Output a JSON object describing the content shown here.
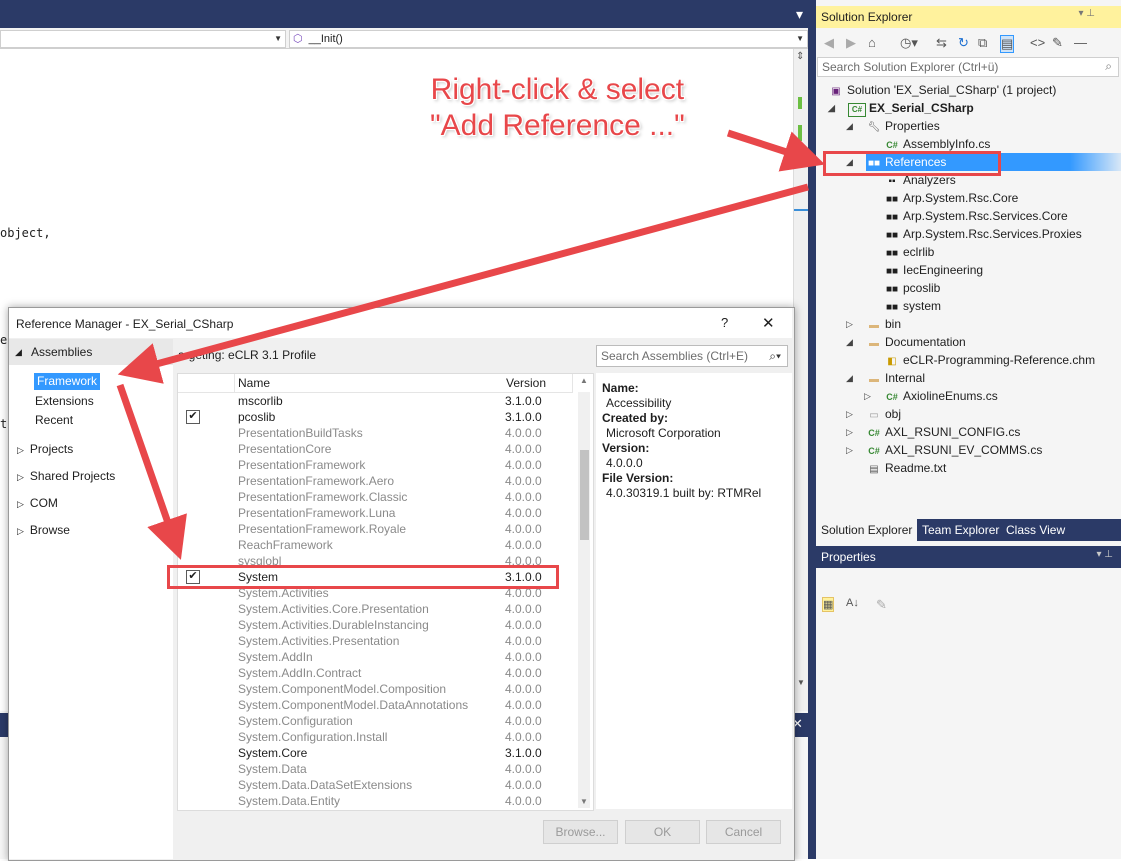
{
  "editor": {
    "nav_right_icon": "⬡",
    "nav_right_label": "__Init()",
    "code_lines": [
      "object,"
    ],
    "stray_chars": [
      "e",
      "t"
    ]
  },
  "solution_explorer": {
    "title": "Solution Explorer",
    "search_placeholder": "Search Solution Explorer (Ctrl+ü)",
    "solution_label": "Solution 'EX_Serial_CSharp' (1 project)",
    "project_label": "EX_Serial_CSharp",
    "properties_label": "Properties",
    "assemblyinfo_label": "AssemblyInfo.cs",
    "references_label": "References",
    "ref_children": [
      {
        "label": "Analyzers",
        "icon": "analyzer-icon"
      },
      {
        "label": "Arp.System.Rsc.Core",
        "icon": "reference-icon"
      },
      {
        "label": "Arp.System.Rsc.Services.Core",
        "icon": "reference-icon"
      },
      {
        "label": "Arp.System.Rsc.Services.Proxies",
        "icon": "reference-icon"
      },
      {
        "label": "eclrlib",
        "icon": "reference-icon"
      },
      {
        "label": "IecEngineering",
        "icon": "reference-icon"
      },
      {
        "label": "pcoslib",
        "icon": "reference-icon"
      },
      {
        "label": "system",
        "icon": "reference-icon"
      }
    ],
    "bin_label": "bin",
    "documentation_label": "Documentation",
    "doc_child_label": "eCLR-Programming-Reference.chm",
    "internal_label": "Internal",
    "internal_child_label": "AxiolineEnums.cs",
    "obj_label": "obj",
    "config_label": "AXL_RSUNI_CONFIG.cs",
    "comms_label": "AXL_RSUNI_EV_COMMS.cs",
    "readme_label": "Readme.txt",
    "tabs": [
      "Solution Explorer",
      "Team Explorer",
      "Class View"
    ]
  },
  "properties_panel": {
    "title": "Properties"
  },
  "dialog": {
    "title": "Reference Manager - EX_Serial_CSharp",
    "help": "?",
    "close": "✕",
    "assemblies_label": "Assemblies",
    "framework_label": "Framework",
    "extensions_label": "Extensions",
    "recent_label": "Recent",
    "projects_label": "Projects",
    "shared_projects_label": "Shared Projects",
    "com_label": "COM",
    "browse_label": "Browse",
    "targeting": "argeting: eCLR 3.1 Profile",
    "search_placeholder": "Search Assemblies (Ctrl+E)",
    "col_name": "Name",
    "col_version": "Version",
    "rows": [
      {
        "name": "mscorlib",
        "version": "3.1.0.0",
        "checked": false,
        "grey": false
      },
      {
        "name": "pcoslib",
        "version": "3.1.0.0",
        "checked": true,
        "grey": false
      },
      {
        "name": "PresentationBuildTasks",
        "version": "4.0.0.0",
        "checked": false,
        "grey": true
      },
      {
        "name": "PresentationCore",
        "version": "4.0.0.0",
        "checked": false,
        "grey": true
      },
      {
        "name": "PresentationFramework",
        "version": "4.0.0.0",
        "checked": false,
        "grey": true
      },
      {
        "name": "PresentationFramework.Aero",
        "version": "4.0.0.0",
        "checked": false,
        "grey": true
      },
      {
        "name": "PresentationFramework.Classic",
        "version": "4.0.0.0",
        "checked": false,
        "grey": true
      },
      {
        "name": "PresentationFramework.Luna",
        "version": "4.0.0.0",
        "checked": false,
        "grey": true
      },
      {
        "name": "PresentationFramework.Royale",
        "version": "4.0.0.0",
        "checked": false,
        "grey": true
      },
      {
        "name": "ReachFramework",
        "version": "4.0.0.0",
        "checked": false,
        "grey": true
      },
      {
        "name": "sysglobl",
        "version": "4.0.0.0",
        "checked": false,
        "grey": true
      },
      {
        "name": "System",
        "version": "3.1.0.0",
        "checked": true,
        "grey": false
      },
      {
        "name": "System.Activities",
        "version": "4.0.0.0",
        "checked": false,
        "grey": true
      },
      {
        "name": "System.Activities.Core.Presentation",
        "version": "4.0.0.0",
        "checked": false,
        "grey": true
      },
      {
        "name": "System.Activities.DurableInstancing",
        "version": "4.0.0.0",
        "checked": false,
        "grey": true
      },
      {
        "name": "System.Activities.Presentation",
        "version": "4.0.0.0",
        "checked": false,
        "grey": true
      },
      {
        "name": "System.AddIn",
        "version": "4.0.0.0",
        "checked": false,
        "grey": true
      },
      {
        "name": "System.AddIn.Contract",
        "version": "4.0.0.0",
        "checked": false,
        "grey": true
      },
      {
        "name": "System.ComponentModel.Composition",
        "version": "4.0.0.0",
        "checked": false,
        "grey": true
      },
      {
        "name": "System.ComponentModel.DataAnnotations",
        "version": "4.0.0.0",
        "checked": false,
        "grey": true
      },
      {
        "name": "System.Configuration",
        "version": "4.0.0.0",
        "checked": false,
        "grey": true
      },
      {
        "name": "System.Configuration.Install",
        "version": "4.0.0.0",
        "checked": false,
        "grey": true
      },
      {
        "name": "System.Core",
        "version": "3.1.0.0",
        "checked": false,
        "grey": false
      },
      {
        "name": "System.Data",
        "version": "4.0.0.0",
        "checked": false,
        "grey": true
      },
      {
        "name": "System.Data.DataSetExtensions",
        "version": "4.0.0.0",
        "checked": false,
        "grey": true
      },
      {
        "name": "System.Data.Entity",
        "version": "4.0.0.0",
        "checked": false,
        "grey": true
      }
    ],
    "details": {
      "name_label": "Name:",
      "name_value": "Accessibility",
      "created_label": "Created by:",
      "created_value": "Microsoft Corporation",
      "version_label": "Version:",
      "version_value": "4.0.0.0",
      "file_version_label": "File Version:",
      "file_version_value": "4.0.30319.1 built by: RTMRel"
    },
    "buttons": {
      "browse": "Browse...",
      "ok": "OK",
      "cancel": "Cancel"
    }
  },
  "annotation": {
    "line1": "Right-click & select",
    "line2": "\"Add Reference ...\""
  },
  "colors": {
    "annotation": "#e8474a",
    "selection": "#3399ff",
    "vs_dark": "#2b3a67"
  }
}
